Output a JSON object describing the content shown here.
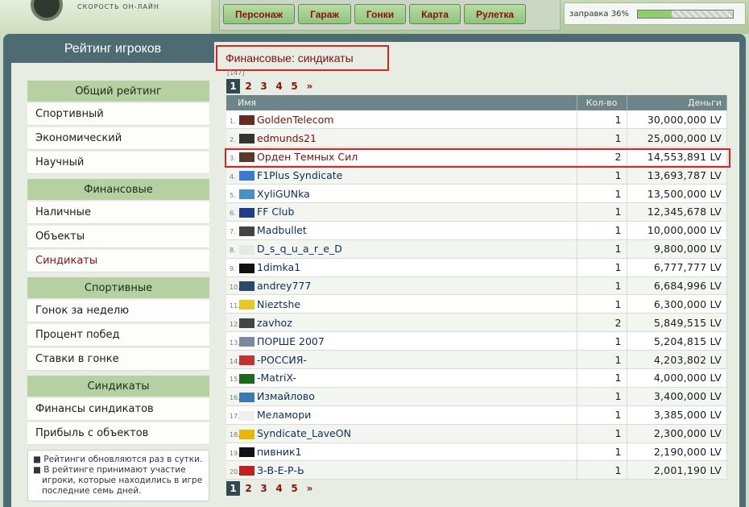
{
  "header": {
    "subtitle": "СКОРОСТЬ ОН-ЛАЙН",
    "nav": [
      "Персонаж",
      "Гараж",
      "Гонки",
      "Карта",
      "Рулетка"
    ],
    "fuel_label": "заправка 36%",
    "fuel_level": 0.36
  },
  "sidebar": {
    "title": "Рейтинг игроков",
    "groups": [
      {
        "head": "Общий рейтинг",
        "items": [
          "Спортивный",
          "Экономический",
          "Научный"
        ]
      },
      {
        "head": "Финансовые",
        "items": [
          "Наличные",
          "Объекты",
          "Синдикаты"
        ]
      },
      {
        "head": "Спортивные",
        "items": [
          "Гонок за неделю",
          "Процент побед",
          "Ставки в гонке"
        ]
      },
      {
        "head": "Синдикаты",
        "items": [
          "Финансы синдикатов",
          "Прибыль с объектов"
        ]
      }
    ],
    "notes": [
      "■  Рейтинги обновляются раз в сутки.",
      "■  В рейтинге принимают участие игроки, которые находились в игре последние семь дней."
    ]
  },
  "main": {
    "title": "Финансовые: синдикаты",
    "total": "[147]",
    "pages": [
      "1",
      "2",
      "3",
      "4",
      "5",
      "»"
    ],
    "current_page": "1",
    "columns": {
      "name": "Имя",
      "count": "Кол-во",
      "money": "Деньги"
    },
    "rows": [
      {
        "rank": "1.",
        "name": "GoldenTelecom",
        "count": "1",
        "money": "30,000,000 LV",
        "color": "#7a1010",
        "icon": "#6a2a20"
      },
      {
        "rank": "2.",
        "name": "edmunds21",
        "count": "1",
        "money": "25,000,000 LV",
        "color": "#7a1010",
        "icon": "#333333"
      },
      {
        "rank": "3.",
        "name": "Орден Темных Сил",
        "count": "2",
        "money": "14,553,891 LV",
        "color": "#7a1010",
        "icon": "#5a3a2a"
      },
      {
        "rank": "4.",
        "name": "F1Plus Syndicate",
        "count": "1",
        "money": "13,693,787 LV",
        "color": "#0e2e55",
        "icon": "#3a7ad0"
      },
      {
        "rank": "5.",
        "name": "XyliGUNka",
        "count": "1",
        "money": "13,500,000 LV",
        "color": "#0e2e55",
        "icon": "#4a90c8"
      },
      {
        "rank": "6.",
        "name": "FF Club",
        "count": "1",
        "money": "12,345,678 LV",
        "color": "#0e2e55",
        "icon": "#1d3f8a"
      },
      {
        "rank": "7.",
        "name": "Madbullet",
        "count": "1",
        "money": "10,000,000 LV",
        "color": "#0e2e55",
        "icon": "#444444"
      },
      {
        "rank": "8.",
        "name": "D_s_q_u_a_r_e_D",
        "count": "1",
        "money": "9,800,000 LV",
        "color": "#0e2e55",
        "icon": "#e8e8e8"
      },
      {
        "rank": "9.",
        "name": "1dimka1",
        "count": "1",
        "money": "6,777,777 LV",
        "color": "#0e2e55",
        "icon": "#111111"
      },
      {
        "rank": "10.",
        "name": "andrey777",
        "count": "1",
        "money": "6,684,996 LV",
        "color": "#0e2e55",
        "icon": "#2a4a6a"
      },
      {
        "rank": "11.",
        "name": "Nieztshe",
        "count": "1",
        "money": "6,300,000 LV",
        "color": "#0e2e55",
        "icon": "#e8c820"
      },
      {
        "rank": "12.",
        "name": "zavhoz",
        "count": "2",
        "money": "5,849,515 LV",
        "color": "#0e2e55",
        "icon": "#444444"
      },
      {
        "rank": "13.",
        "name": "ПОРШЕ 2007",
        "count": "1",
        "money": "5,204,815 LV",
        "color": "#0e2e55",
        "icon": "#7a8a9a"
      },
      {
        "rank": "14.",
        "name": "-РОССИЯ-",
        "count": "1",
        "money": "4,203,802 LV",
        "color": "#0e2e55",
        "icon": "#c83030"
      },
      {
        "rank": "15.",
        "name": "-MatriX-",
        "count": "1",
        "money": "4,000,000 LV",
        "color": "#0e2e55",
        "icon": "#1a6a1a"
      },
      {
        "rank": "16.",
        "name": "Измайлово",
        "count": "1",
        "money": "3,400,000 LV",
        "color": "#0e2e55",
        "icon": "#3a78b8"
      },
      {
        "rank": "17.",
        "name": "Меламори",
        "count": "1",
        "money": "3,385,000 LV",
        "color": "#0e2e55",
        "icon": "#f0f0f0"
      },
      {
        "rank": "18.",
        "name": "Syndicate_LaveON",
        "count": "1",
        "money": "2,300,000 LV",
        "color": "#0e2e55",
        "icon": "#e8b800"
      },
      {
        "rank": "19.",
        "name": "пивник1",
        "count": "1",
        "money": "2,190,000 LV",
        "color": "#0e2e55",
        "icon": "#111111"
      },
      {
        "rank": "20.",
        "name": "З-В-Е-Р-Ь",
        "count": "1",
        "money": "2,001,190 LV",
        "color": "#0e2e55",
        "icon": "#c02020"
      }
    ]
  }
}
